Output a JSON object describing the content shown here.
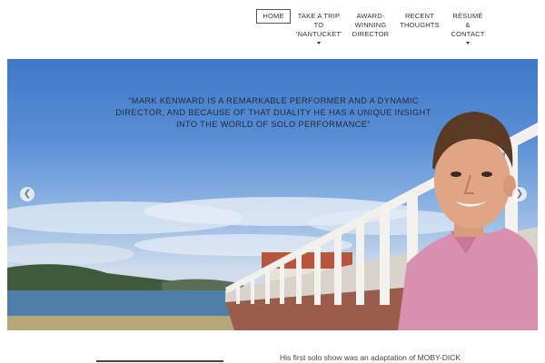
{
  "nav": {
    "items": [
      {
        "label": "HOME",
        "active": true
      },
      {
        "label": "TAKE A TRIP TO 'NANTUCKET'",
        "has_dropdown": true
      },
      {
        "label": "AWARD-WINNING DIRECTOR"
      },
      {
        "label": "RECENT THOUGHTS"
      },
      {
        "label": "RÉSUMÉ & CONTACT",
        "has_dropdown": true
      }
    ]
  },
  "hero": {
    "quote": "\"MARK KENWARD IS A REMARKABLE PERFORMER AND A DYNAMIC DIRECTOR, AND BECAUSE OF THAT DUALITY HE HAS A UNIQUE INSIGHT INTO THE WORLD OF SOLO PERFORMANCE\"",
    "prev_icon": "chevron-left-icon",
    "next_icon": "chevron-right-icon"
  },
  "content": {
    "intro": "His first solo show was an adaptation of MOBY-DICK"
  },
  "colors": {
    "sky_top": "#3f78c8",
    "sea": "#4f7fa9",
    "shirt": "#d98fb0"
  }
}
